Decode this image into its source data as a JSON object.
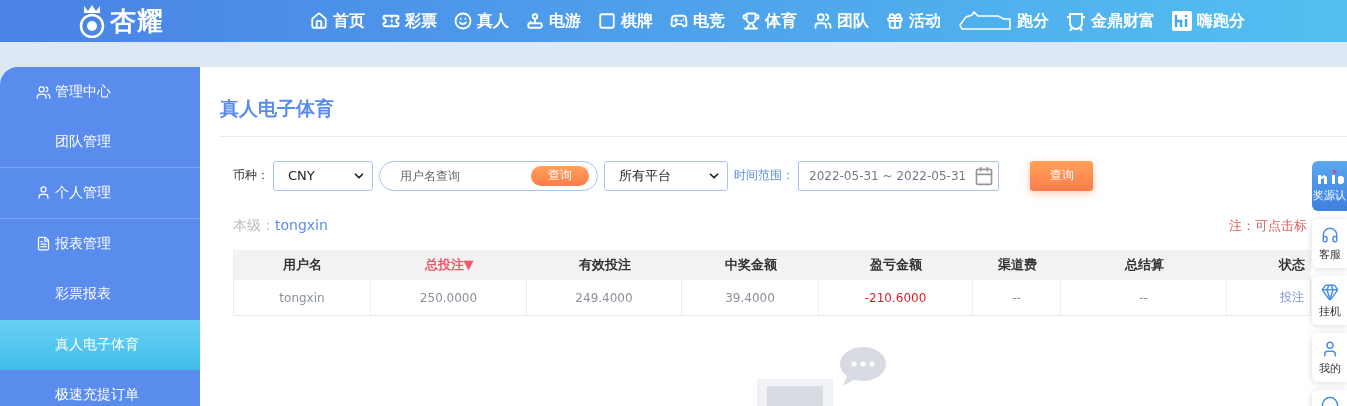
{
  "header": {
    "logo": "杏耀",
    "nav": [
      "首页",
      "彩票",
      "真人",
      "电游",
      "棋牌",
      "电竞",
      "体育",
      "团队",
      "活动",
      "跑分",
      "金鼎财富",
      "嗨跑分"
    ]
  },
  "sidebar": {
    "items": [
      {
        "label": "管理中心",
        "kind": "group",
        "selected": false
      },
      {
        "label": "团队管理",
        "kind": "link",
        "selected": false
      },
      {
        "label": "个人管理",
        "kind": "group",
        "selected": false
      },
      {
        "label": "报表管理",
        "kind": "group",
        "selected": false
      },
      {
        "label": "彩票报表",
        "kind": "link",
        "selected": false
      },
      {
        "label": "真人电子体育",
        "kind": "link",
        "selected": true
      },
      {
        "label": "极速充提订单",
        "kind": "link",
        "selected": false
      }
    ]
  },
  "page_title": "真人电子体育",
  "filters": {
    "currency_label": "币种：",
    "currency": "CNY",
    "username": {
      "placeholder": "用户名查询",
      "button": "查询"
    },
    "platform": "所有平台",
    "time_label": "时间范围：",
    "date_range": "2022-05-31 ~ 2022-05-31",
    "search_button": "查询"
  },
  "level_label": "本级：",
  "level_user": "tongxin",
  "note": "注：可点击标",
  "table": {
    "columns": [
      {
        "label": "用户名",
        "sorted": false
      },
      {
        "label": "总投注▼",
        "sorted": true
      },
      {
        "label": "有效投注",
        "sorted": false
      },
      {
        "label": "中奖金额",
        "sorted": false
      },
      {
        "label": "盈亏金额",
        "sorted": false
      },
      {
        "label": "渠道费",
        "sorted": false
      },
      {
        "label": "总结算",
        "sorted": false
      },
      {
        "label": "状态",
        "sorted": false
      }
    ],
    "rows": [
      [
        {
          "text": "tongxin",
          "kind": "plain"
        },
        {
          "text": "250.0000",
          "kind": "plain"
        },
        {
          "text": "249.4000",
          "kind": "plain"
        },
        {
          "text": "39.4000",
          "kind": "plain"
        },
        {
          "text": "-210.6000",
          "kind": "loss"
        },
        {
          "text": "--",
          "kind": "plain"
        },
        {
          "text": "--",
          "kind": "plain"
        },
        {
          "text": "投注",
          "kind": "link"
        }
      ]
    ]
  },
  "float_widgets": [
    "奖源认",
    "客服",
    "挂机",
    "我的"
  ]
}
